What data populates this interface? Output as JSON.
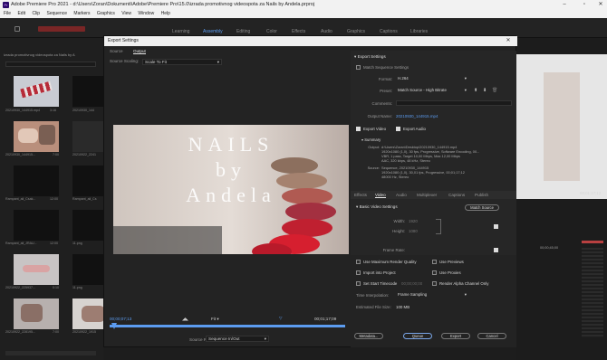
{
  "app": {
    "title": "Adobe Premiere Pro 2021 - d:\\Users\\Zoran\\Dokumenti\\Adobe\\Premiere Pro\\15.0\\izrada promotivnog videospota za Nails by Andela.prproj",
    "icon_label": "Pr",
    "window_controls": {
      "minimize": "–",
      "maximize": "▫",
      "close": "✕"
    }
  },
  "menu": [
    "File",
    "Edit",
    "Clip",
    "Sequence",
    "Markers",
    "Graphics",
    "View",
    "Window",
    "Help"
  ],
  "workspaces": {
    "items": [
      "Learning",
      "Assembly",
      "Editing",
      "Color",
      "Effects",
      "Audio",
      "Graphics",
      "Captions",
      "Libraries"
    ],
    "active": "Assembly"
  },
  "project": {
    "filename": "izrada promotivnog videospota za Nails by A",
    "items": [
      {
        "name": "20210930_144915.mp4",
        "dur": "3:16"
      },
      {
        "name": "20210930_144",
        "dur": ""
      },
      {
        "name": "20210930_144915...",
        "dur": "7:00"
      },
      {
        "name": "20210922_2241",
        "dur": ""
      },
      {
        "name": "Rampant_ali_Csak...",
        "dur": "12:00"
      },
      {
        "name": "Rampant_ali_Cs",
        "dur": ""
      },
      {
        "name": "Rampant_ali_JRAU...",
        "dur": "12:00"
      },
      {
        "name": "11.png",
        "dur": ""
      },
      {
        "name": "20210922_225937...",
        "dur": "0:10"
      },
      {
        "name": "11.png",
        "dur": ""
      },
      {
        "name": "20210922_228195...",
        "dur": "7:00"
      },
      {
        "name": "20210922_1915",
        "dur": ""
      }
    ]
  },
  "dialog": {
    "title": "Export Settings",
    "close": "✕",
    "tabs": [
      "Source",
      "Output"
    ],
    "active_tab": "Output",
    "source_scaling_label": "Source Scaling:",
    "source_scaling_value": "Scale To Fit",
    "preview_title_lines": [
      "NAILS",
      "by",
      "Andela"
    ],
    "timecode_in": "00;00;07;13",
    "timecode_out": "00;01;17;09",
    "zoom_value": "Fit",
    "source_range_label": "Source Range:",
    "source_range_value": "Sequence In/Out",
    "export_settings": {
      "heading": "Export Settings",
      "match_sequence": "Match Sequence Settings",
      "format_label": "Format:",
      "format_value": "H.264",
      "preset_label": "Preset:",
      "preset_value": "Match Source - High Bitrate",
      "comments_label": "Comments:",
      "output_name_label": "Output Name:",
      "output_name_value": "20210930_144915.mp4",
      "export_video": "Export Video",
      "export_audio": "Export Audio"
    },
    "summary": {
      "heading": "Summary",
      "output_label": "Output:",
      "output_lines": [
        "d:\\Users\\Zoran\\Desktop\\20210930_144915.mp4",
        "1920x1080 (1,0), 30 fps, Progressive, Software Encoding, 00...",
        "VBR, 1 pass, Target 10,00 Mbps, Max 12,00 Mbps",
        "AAC, 320 kbps, 48 kHz, Stereo"
      ],
      "source_label": "Source:",
      "source_lines": [
        "Sequence, 20210930_144915",
        "1920x1080 (1,0), 30,01 fps, Progressive, 00;01;17;12",
        "48000 Hz, Stereo"
      ]
    },
    "subtabs": [
      "Effects",
      "Video",
      "Audio",
      "Multiplexer",
      "Captions",
      "Publish"
    ],
    "active_subtab": "Video",
    "basic_video": {
      "heading": "Basic Video Settings",
      "match_source_btn": "Match Source",
      "width_label": "Width:",
      "width_value": "1920",
      "height_label": "Height:",
      "height_value": "1080",
      "frame_rate_label": "Frame Rate:"
    },
    "options": {
      "max_render": "Use Maximum Render Quality",
      "use_previews": "Use Previews",
      "import_project": "Import into Project",
      "use_proxies": "Use Proxies",
      "set_start_tc": "Set Start Timecode",
      "start_tc_value": "00;00;00;00",
      "alpha_only": "Render Alpha Channel Only"
    },
    "time_interp_label": "Time Interpolation:",
    "time_interp_value": "Frame Sampling",
    "file_size_label": "Estimated File Size:",
    "file_size_value": "100 MB",
    "buttons": {
      "metadata": "Metadata...",
      "queue": "Queue",
      "export": "Export",
      "cancel": "Cancel"
    }
  },
  "right_panel": {
    "timecode": "00;01;17;12",
    "timeline_tc": "00;00;45;00"
  },
  "colors": {
    "accent": "#5c9cf0",
    "bg": "#232323",
    "titlebar": "#f0f0f0"
  }
}
